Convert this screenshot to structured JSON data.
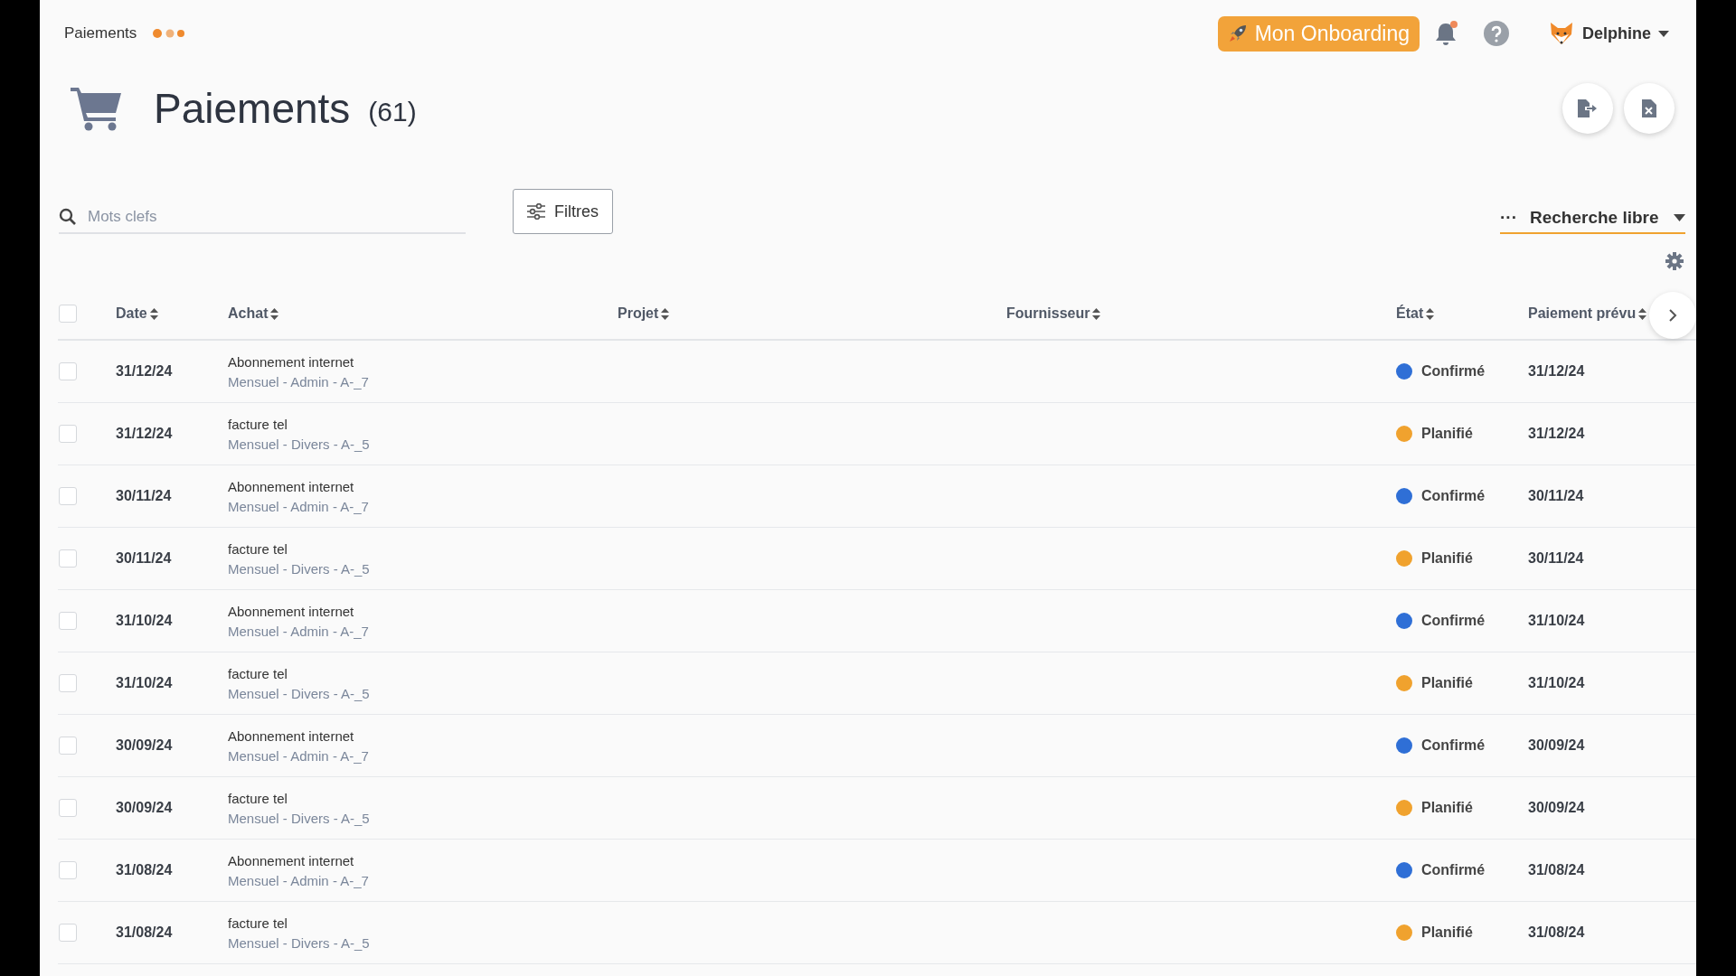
{
  "top_bar": {
    "breadcrumb": "Paiements",
    "onboarding_button": "Mon Onboarding",
    "user": {
      "name": "Delphine"
    }
  },
  "header": {
    "title": "Paiements",
    "count": "(61)"
  },
  "search": {
    "placeholder": "Mots clefs"
  },
  "filters_button": "Filtres",
  "search_mode": {
    "menu_icon": "···",
    "label": "Recherche libre"
  },
  "table": {
    "select_all": {
      "checked": false
    },
    "columns": [
      "Date",
      "Achat",
      "Projet",
      "Fournisseur",
      "État",
      "Paiement prévu"
    ],
    "rows": [
      {
        "checked": false,
        "date": "31/12/24",
        "achat": "Abonnement internet",
        "details": "Mensuel - Admin - A-_7",
        "etat": "Confirmé",
        "color": "#2f6fd6",
        "paiement": "31/12/24"
      },
      {
        "checked": false,
        "date": "31/12/24",
        "achat": "facture tel",
        "details": "Mensuel - Divers - A-_5",
        "etat": "Planifié",
        "color": "#f0a22e",
        "paiement": "31/12/24"
      },
      {
        "checked": false,
        "date": "30/11/24",
        "achat": "Abonnement internet",
        "details": "Mensuel - Admin - A-_7",
        "etat": "Confirmé",
        "color": "#2f6fd6",
        "paiement": "30/11/24"
      },
      {
        "checked": false,
        "date": "30/11/24",
        "achat": "facture tel",
        "details": "Mensuel - Divers - A-_5",
        "etat": "Planifié",
        "color": "#f0a22e",
        "paiement": "30/11/24"
      },
      {
        "checked": false,
        "date": "31/10/24",
        "achat": "Abonnement internet",
        "details": "Mensuel - Admin - A-_7",
        "etat": "Confirmé",
        "color": "#2f6fd6",
        "paiement": "31/10/24"
      },
      {
        "checked": false,
        "date": "31/10/24",
        "achat": "facture tel",
        "details": "Mensuel - Divers - A-_5",
        "etat": "Planifié",
        "color": "#f0a22e",
        "paiement": "31/10/24"
      },
      {
        "checked": false,
        "date": "30/09/24",
        "achat": "Abonnement internet",
        "details": "Mensuel - Admin - A-_7",
        "etat": "Confirmé",
        "color": "#2f6fd6",
        "paiement": "30/09/24"
      },
      {
        "checked": false,
        "date": "30/09/24",
        "achat": "facture tel",
        "details": "Mensuel - Divers - A-_5",
        "etat": "Planifié",
        "color": "#f0a22e",
        "paiement": "30/09/24"
      },
      {
        "checked": false,
        "date": "31/08/24",
        "achat": "Abonnement internet",
        "details": "Mensuel - Admin - A-_7",
        "etat": "Confirmé",
        "color": "#2f6fd6",
        "paiement": "31/08/24"
      },
      {
        "checked": false,
        "date": "31/08/24",
        "achat": "facture tel",
        "details": "Mensuel - Divers - A-_5",
        "etat": "Planifié",
        "color": "#f0a22e",
        "paiement": "31/08/24"
      }
    ]
  }
}
